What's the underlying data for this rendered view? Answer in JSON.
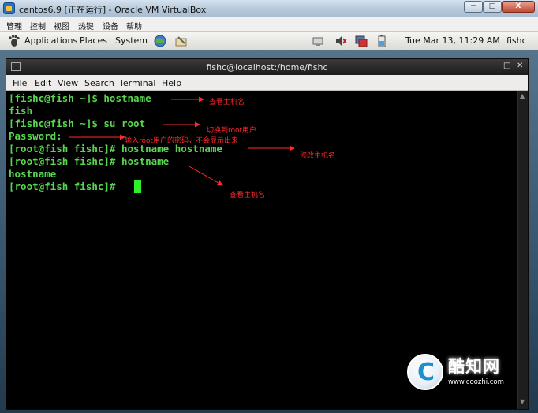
{
  "host_window": {
    "title": "centos6.9 [正在运行] - Oracle VM VirtualBox",
    "minimize": "─",
    "maximize": "□",
    "close": "X"
  },
  "host_menu": [
    "管理",
    "控制",
    "视图",
    "热键",
    "设备",
    "帮助"
  ],
  "gnome_panel": {
    "applications": "Applications",
    "places": "Places",
    "system": "System",
    "clock": "Tue Mar 13, 11:29 AM",
    "user": "fishc"
  },
  "terminal": {
    "title": "fishc@localhost:/home/fishc",
    "menu": [
      "File",
      "Edit",
      "View",
      "Search",
      "Terminal",
      "Help"
    ],
    "lines": [
      "[fishc@fish ~]$ hostname",
      "fish",
      "[fishc@fish ~]$ su root",
      "Password:",
      "[root@fish fishc]# hostname hostname",
      "[root@fish fishc]# hostname",
      "hostname",
      "[root@fish fishc]# "
    ]
  },
  "annotations": {
    "view_hostname_1": "查看主机名",
    "switch_root": "切换到root用户",
    "enter_password": "输入root用户的密码，不会显示出来",
    "modify_hostname": "修改主机名",
    "view_hostname_2": "查看主机名"
  },
  "watermark": {
    "brand": "酷知网",
    "url": "www.coozhi.com"
  },
  "colors": {
    "terminal_text": "#58d64f",
    "annotation": "#ff2a2a"
  }
}
